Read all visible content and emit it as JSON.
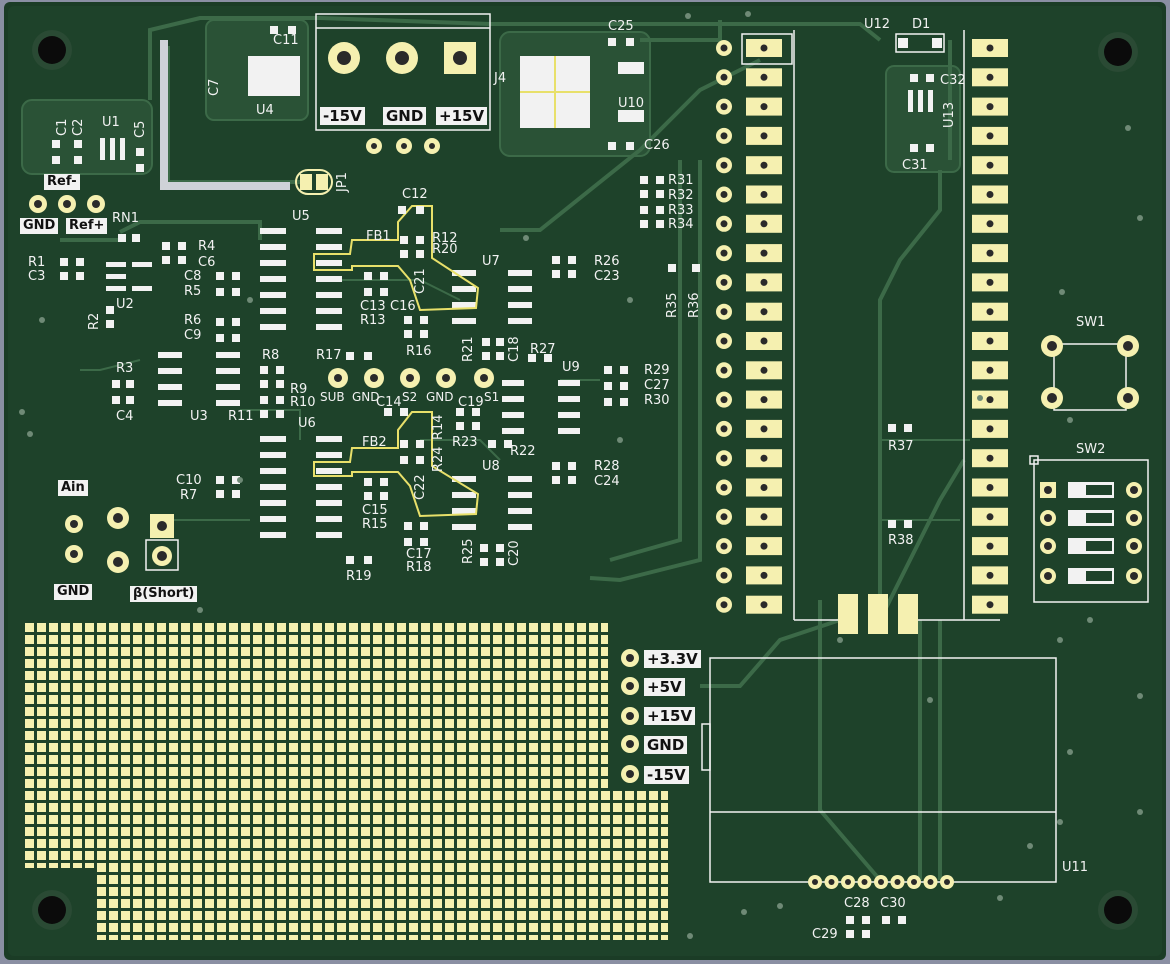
{
  "board": {
    "colors": {
      "substrate": "#1b3c26",
      "copper": "#2f5a3a",
      "trace": "#3c6a48",
      "pad": "#f5f0b0",
      "silk": "#f2f2f2",
      "edge": "#8a8fa3"
    }
  },
  "connectors": {
    "rail_labels": [
      "-15V",
      "GND",
      "+15V"
    ],
    "ref_labels": [
      "Ref-",
      "GND",
      "Ref+"
    ],
    "analog_labels": [
      "Ain",
      "GND",
      "β(Short)"
    ],
    "probe_labels": [
      "SUB",
      "GND",
      "S2",
      "GND",
      "S1"
    ],
    "supply_labels": [
      "+3.3V",
      "+5V",
      "+15V",
      "GND",
      "-15V"
    ]
  },
  "components": [
    {
      "ref": "C11"
    },
    {
      "ref": "C7"
    },
    {
      "ref": "U4"
    },
    {
      "ref": "J4"
    },
    {
      "ref": "C25"
    },
    {
      "ref": "U10"
    },
    {
      "ref": "C26"
    },
    {
      "ref": "U12"
    },
    {
      "ref": "D1"
    },
    {
      "ref": "C32"
    },
    {
      "ref": "U13"
    },
    {
      "ref": "C31"
    },
    {
      "ref": "C1"
    },
    {
      "ref": "C2"
    },
    {
      "ref": "U1"
    },
    {
      "ref": "C5"
    },
    {
      "ref": "JP1"
    },
    {
      "ref": "C12"
    },
    {
      "ref": "RN1"
    },
    {
      "ref": "U5"
    },
    {
      "ref": "FB1"
    },
    {
      "ref": "R12"
    },
    {
      "ref": "R20"
    },
    {
      "ref": "R4"
    },
    {
      "ref": "C6"
    },
    {
      "ref": "R1"
    },
    {
      "ref": "C3"
    },
    {
      "ref": "C8"
    },
    {
      "ref": "R5"
    },
    {
      "ref": "U2"
    },
    {
      "ref": "R2"
    },
    {
      "ref": "C13"
    },
    {
      "ref": "C16"
    },
    {
      "ref": "C21"
    },
    {
      "ref": "R13"
    },
    {
      "ref": "U7"
    },
    {
      "ref": "R26"
    },
    {
      "ref": "C23"
    },
    {
      "ref": "R31"
    },
    {
      "ref": "R32"
    },
    {
      "ref": "R33"
    },
    {
      "ref": "R34"
    },
    {
      "ref": "R35"
    },
    {
      "ref": "R36"
    },
    {
      "ref": "R6"
    },
    {
      "ref": "C9"
    },
    {
      "ref": "R16"
    },
    {
      "ref": "R21"
    },
    {
      "ref": "C18"
    },
    {
      "ref": "R27"
    },
    {
      "ref": "U9"
    },
    {
      "ref": "R29"
    },
    {
      "ref": "C27"
    },
    {
      "ref": "R30"
    },
    {
      "ref": "R3"
    },
    {
      "ref": "R8"
    },
    {
      "ref": "R17"
    },
    {
      "ref": "R9"
    },
    {
      "ref": "R10"
    },
    {
      "ref": "R11"
    },
    {
      "ref": "C4"
    },
    {
      "ref": "U3"
    },
    {
      "ref": "U6"
    },
    {
      "ref": "C14"
    },
    {
      "ref": "C19"
    },
    {
      "ref": "FB2"
    },
    {
      "ref": "R14"
    },
    {
      "ref": "R24"
    },
    {
      "ref": "R23"
    },
    {
      "ref": "R22"
    },
    {
      "ref": "U8"
    },
    {
      "ref": "R28"
    },
    {
      "ref": "C24"
    },
    {
      "ref": "C10"
    },
    {
      "ref": "R7"
    },
    {
      "ref": "C22"
    },
    {
      "ref": "C15"
    },
    {
      "ref": "R15"
    },
    {
      "ref": "C17"
    },
    {
      "ref": "R18"
    },
    {
      "ref": "R25"
    },
    {
      "ref": "C20"
    },
    {
      "ref": "R19"
    },
    {
      "ref": "SW1"
    },
    {
      "ref": "SW2"
    },
    {
      "ref": "R37"
    },
    {
      "ref": "R38"
    },
    {
      "ref": "U11"
    },
    {
      "ref": "C28"
    },
    {
      "ref": "C30"
    },
    {
      "ref": "C29"
    }
  ]
}
